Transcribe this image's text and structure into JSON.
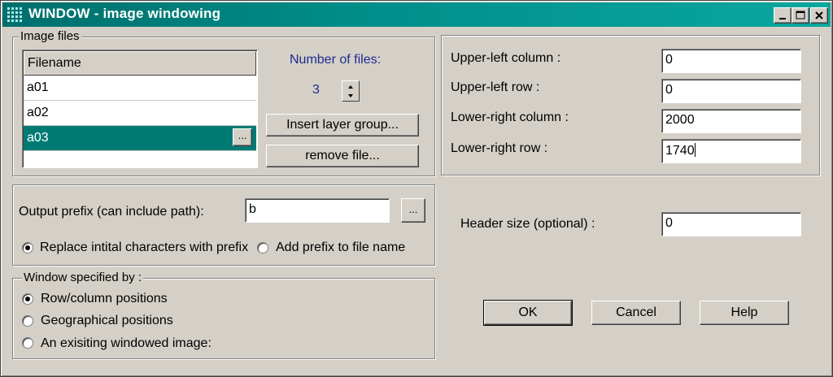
{
  "window": {
    "title": "WINDOW - image windowing",
    "controls": [
      "minimize-icon",
      "maximize-icon",
      "close-icon"
    ]
  },
  "image_files": {
    "legend": "Image files",
    "column_header": "Filename",
    "rows": [
      "a01",
      "a02",
      "a03"
    ],
    "selected_index": 2,
    "row_browse_label": "...",
    "number_of_files_label": "Number of files:",
    "number_of_files_value": "3",
    "insert_layer_group_label": "Insert layer group...",
    "remove_file_label": "remove file..."
  },
  "coords": {
    "upper_left_column_label": "Upper-left column :",
    "upper_left_column_value": "0",
    "upper_left_row_label": "Upper-left row :",
    "upper_left_row_value": "0",
    "lower_right_column_label": "Lower-right column :",
    "lower_right_column_value": "2000",
    "lower_right_row_label": "Lower-right row :",
    "lower_right_row_value": "1740"
  },
  "output": {
    "prefix_label": "Output prefix (can include path):",
    "prefix_value": "b",
    "browse_label": "...",
    "replace_label": "Replace intital characters with prefix",
    "add_label": "Add prefix to file name",
    "selected": "replace"
  },
  "header": {
    "label": "Header size (optional) :",
    "value": "0"
  },
  "window_spec": {
    "legend": "Window specified by :",
    "options": [
      "Row/column positions",
      "Geographical positions",
      "An exisiting windowed image:"
    ],
    "selected_index": 0
  },
  "actions": {
    "ok_label": "OK",
    "cancel_label": "Cancel",
    "help_label": "Help"
  },
  "colors": {
    "title_bar": "#007b73",
    "selection": "#007b73",
    "number_text": "#1f2a8c",
    "face": "#d4d0c8"
  }
}
